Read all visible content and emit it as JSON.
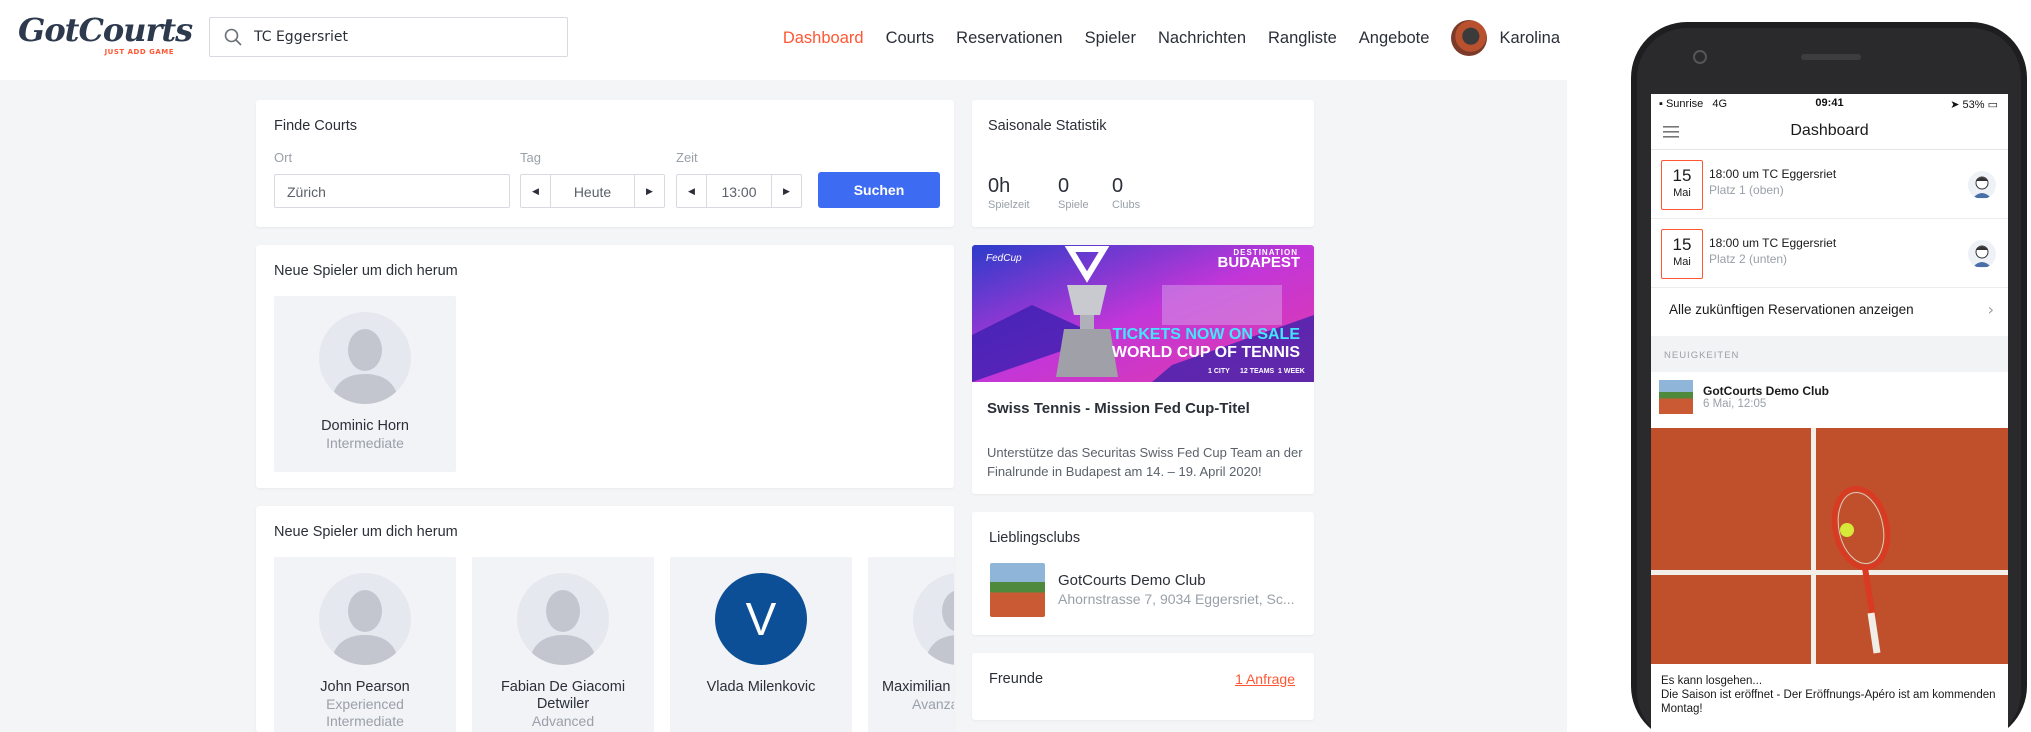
{
  "header": {
    "logo_text": "GotCourts",
    "logo_tagline": "JUST ADD GAME",
    "search_value": "TC Eggersriet",
    "nav": [
      "Dashboard",
      "Courts",
      "Reservationen",
      "Spieler",
      "Nachrichten",
      "Rangliste",
      "Angebote"
    ],
    "active_nav": "Dashboard",
    "user_name": "Karolina"
  },
  "finde_courts": {
    "title": "Finde Courts",
    "ort_label": "Ort",
    "ort_value": "Zürich",
    "tag_label": "Tag",
    "tag_value": "Heute",
    "zeit_label": "Zeit",
    "zeit_value": "13:00",
    "search_button": "Suchen"
  },
  "neue_spieler_1": {
    "title": "Neue Spieler um dich herum",
    "players": [
      {
        "name": "Dominic Horn",
        "level": "Intermediate"
      }
    ]
  },
  "neue_spieler_2": {
    "title": "Neue Spieler um dich herum",
    "players": [
      {
        "name": "John Pearson",
        "level_1": "Experienced",
        "level_2": "Intermediate"
      },
      {
        "name": "Fabian De Giacomi Detwiler",
        "level": "Advanced"
      },
      {
        "name": "Vlada Milenkovic",
        "initial": "V"
      },
      {
        "name": "Maximilian",
        "level": "Avanza"
      }
    ]
  },
  "statistik": {
    "title": "Saisonale Statistik",
    "items": [
      {
        "value": "0h",
        "label": "Spielzeit"
      },
      {
        "value": "0",
        "label": "Spiele"
      },
      {
        "value": "0",
        "label": "Clubs"
      }
    ]
  },
  "banner": {
    "brand": "FedCup",
    "destination": "DESTINATION",
    "city": "BUDAPEST",
    "tickets": "TICKETS NOW ON SALE",
    "world_cup": "WORLD CUP OF TENNIS",
    "facts": [
      "1 CITY",
      "12 TEAMS",
      "1 WEEK"
    ]
  },
  "news": {
    "title": "Swiss Tennis - Mission Fed Cup-Titel",
    "text": "Unterstütze das Securitas Swiss Fed Cup Team an der Finalrunde in Budapest am 14. – 19. April 2020!"
  },
  "lieblingsclubs": {
    "title": "Lieblingsclubs",
    "club_name": "GotCourts Demo Club",
    "club_address": "Ahornstrasse 7, 9034 Eggersriet, Sc..."
  },
  "freunde": {
    "title": "Freunde",
    "link": "1 Anfrage"
  },
  "phone": {
    "carrier": "Sunrise",
    "network": "4G",
    "time": "09:41",
    "battery": "53%",
    "title": "Dashboard",
    "reservations": [
      {
        "day": "15",
        "month": "Mai",
        "time_place": "18:00 um TC Eggersriet",
        "court": "Platz 1 (oben)"
      },
      {
        "day": "15",
        "month": "Mai",
        "time_place": "18:00 um TC Eggersriet",
        "court": "Platz 2 (unten)"
      }
    ],
    "all_reservations": "Alle zukünftigen Reservationen anzeigen",
    "news_label": "NEUIGKEITEN",
    "post_club": "GotCourts Demo Club",
    "post_date": "6 Mai, 12:05",
    "post_line1": "Es kann losgehen...",
    "post_line2": "Die Saison ist eröffnet - Der Eröffnungs-Apéro ist am kommenden Montag!"
  },
  "colors": {
    "accent": "#ff5733",
    "primary_button": "#3d6cf2",
    "clay": "#c4532e"
  }
}
